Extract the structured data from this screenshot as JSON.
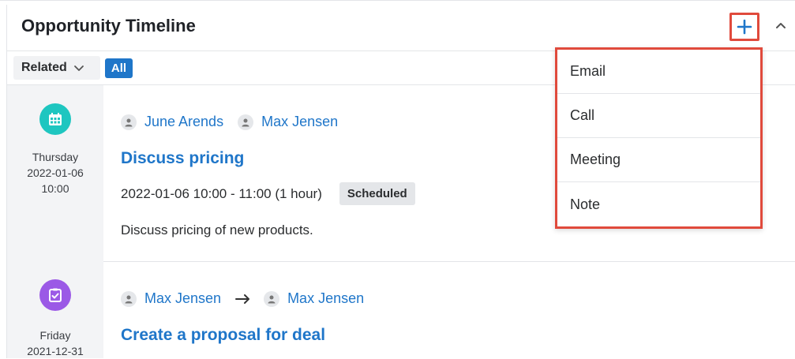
{
  "header": {
    "title": "Opportunity Timeline"
  },
  "filter": {
    "related_label": "Related",
    "all_label": "All"
  },
  "menu": {
    "items": [
      "Email",
      "Call",
      "Meeting",
      "Note"
    ]
  },
  "activities": [
    {
      "type_icon": "calendar-icon",
      "color": "#1ec6c0",
      "day": "Thursday",
      "date": "2022-01-06",
      "time": "10:00",
      "people": [
        "June Arends",
        "Max Jensen"
      ],
      "title": "Discuss pricing",
      "when": "2022-01-06 10:00 - 11:00 (1 hour)",
      "status": "Scheduled",
      "description": "Discuss pricing of new products."
    },
    {
      "type_icon": "task-icon",
      "color": "#9b59e6",
      "day": "Friday",
      "date": "2021-12-31",
      "from": "Max Jensen",
      "to": "Max Jensen",
      "title": "Create a proposal for deal"
    }
  ],
  "colors": {
    "accent": "#1f76c9",
    "highlight": "#e04a3c"
  }
}
